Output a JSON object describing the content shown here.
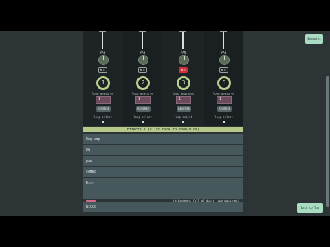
{
  "channels": [
    {
      "pan_label": "PAN",
      "mute_label": "MUT",
      "loop_number": "1",
      "loop_label": "loop measures",
      "measures_value": "1",
      "reverse_label": "REVERSE",
      "loop_select_label": "loop select",
      "muted": false
    },
    {
      "pan_label": "PAN",
      "mute_label": "MUT",
      "loop_number": "2",
      "loop_label": "loop measures",
      "measures_value": "1",
      "reverse_label": "REVERSE",
      "loop_select_label": "loop select",
      "muted": false
    },
    {
      "pan_label": "PAN",
      "mute_label": "MUT",
      "loop_number": "3",
      "loop_label": "loop measures",
      "measures_value": "1",
      "reverse_label": "REVERSE",
      "loop_select_label": "loop select",
      "muted": true
    },
    {
      "pan_label": "PAN",
      "mute_label": "MUT",
      "loop_number": "5",
      "loop_label": "loop measures",
      "measures_value": "1",
      "reverse_label": "REVERSE",
      "loop_select_label": "loop select",
      "muted": false
    }
  ],
  "effects": {
    "header": "Effects 1 (click back to show/hide)",
    "items": [
      "Eng-amp",
      "EQ",
      "pan",
      "COMBO",
      "Dist"
    ],
    "overlay_text": "(a basement full of dusty tape machines)",
    "bottom_item": "RISSO"
  },
  "side": {
    "top_right_button": "Examples",
    "bottom_right_button": "Back to Top"
  },
  "colors": {
    "accent": "#b5c98a",
    "mute_active": "#d0303a",
    "panel": "#46585c"
  }
}
